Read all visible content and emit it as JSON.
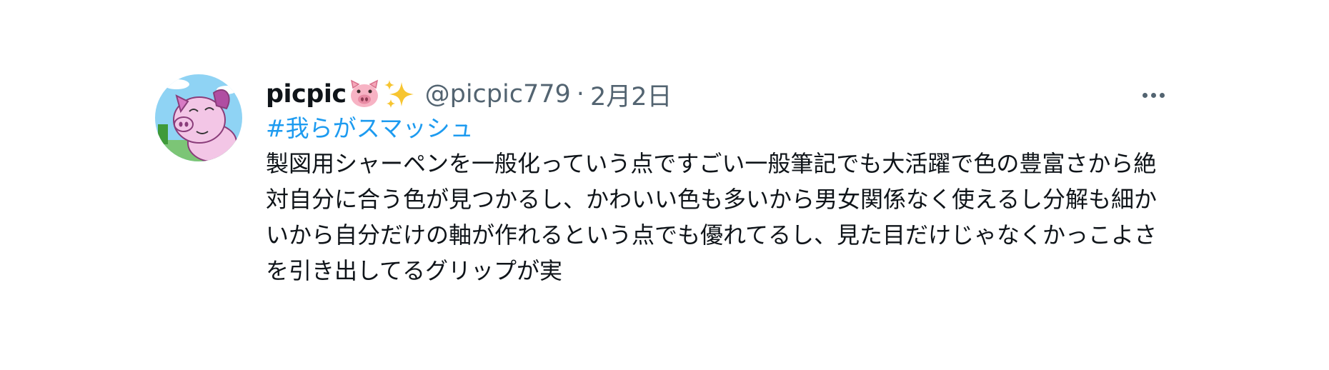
{
  "post": {
    "display_name": "picpic",
    "name_icons": [
      "pig-face-icon",
      "sparkles-icon"
    ],
    "handle": "@picpic779",
    "separator": "·",
    "date": "2月2日",
    "hashtag": "#我らがスマッシュ",
    "text": "製図用シャーペンを一般化っていう点ですごい一般筆記でも大活躍で色の豊富さから絶対自分に合う色が見つかるし、かわいい色も多いから男女関係なく使えるし分解も細かいから自分だけの軸が作れるという点でも優れてるし、見た目だけじゃなくかっこよさを引き出してるグリップが実",
    "more_icon": "more-horizontal-icon",
    "colors": {
      "text": "#0f1419",
      "muted": "#536471",
      "link": "#1d9bf0"
    }
  }
}
